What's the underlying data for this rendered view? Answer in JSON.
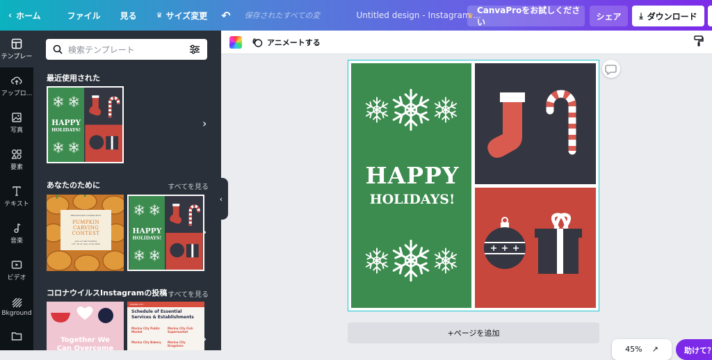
{
  "topbar": {
    "home": "ホーム",
    "file": "ファイル",
    "view": "見る",
    "resize": "サイズ変更",
    "saved_status": "保存されたすべての変",
    "design_title": "Untitled design - Instagram ...",
    "pro_button": "CanvaProをお試しください",
    "share": "シェア",
    "download": "ダウンロード"
  },
  "rail": {
    "items": [
      {
        "label": "テンプレー",
        "icon": "template-icon"
      },
      {
        "label": "アップロ...",
        "icon": "upload-icon"
      },
      {
        "label": "写真",
        "icon": "photo-icon"
      },
      {
        "label": "要素",
        "icon": "elements-icon"
      },
      {
        "label": "テキスト",
        "icon": "text-icon"
      },
      {
        "label": "音楽",
        "icon": "music-icon"
      },
      {
        "label": "ビデオ",
        "icon": "video-icon"
      },
      {
        "label": "Bkground",
        "icon": "background-icon"
      }
    ]
  },
  "panel": {
    "search_placeholder": "検索テンプレート",
    "recent_title": "最近使用された",
    "for_you_title": "あなたのために",
    "see_all": "すべてを見る",
    "corona_title": "コロナウイルスInstagramの投稿",
    "pumpkin": {
      "small": "BROOKTOWN COMMUNITY",
      "title1": "PUMPKIN CARVING",
      "title2": "CONTEST",
      "details": "Join our fall tradition\nOct. 26 at 7pm, Town Park"
    },
    "together": "Together We\nCan Overcome",
    "schedule": {
      "header": "MARINA CITY",
      "title": "Schedule of Essential Services & Establishments",
      "col1_title": "Marina City Public Market",
      "col2_title": "Marina City Fish Supermarket",
      "col3_title": "Marina City Bakery",
      "col4_title": "Marina City Drugstore"
    }
  },
  "toolbar": {
    "animate": "アニメートする"
  },
  "design": {
    "happy": "HAPPY",
    "holidays": "HOLIDAYS!",
    "colors": {
      "green": "#3c8b4f",
      "dark": "#343642",
      "red": "#c8473d",
      "white": "#ffffff"
    }
  },
  "add_page": "+ページを追加",
  "zoom": "45%",
  "help": "助けて？"
}
